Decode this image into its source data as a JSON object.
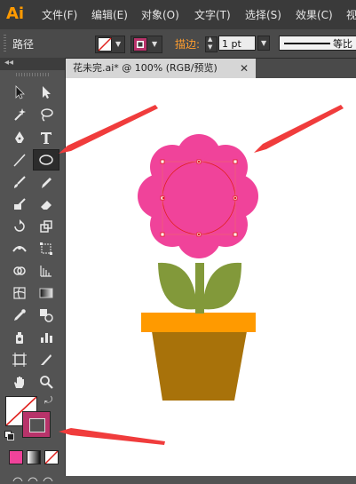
{
  "app": {
    "logo_text": "Ai",
    "menu": [
      "文件(F)",
      "编辑(E)",
      "对象(O)",
      "文字(T)",
      "选择(S)",
      "效果(C)",
      "视"
    ]
  },
  "control_bar": {
    "selection_label": "路径",
    "stroke_label": "描边:",
    "stroke_weight": "1 pt",
    "stroke_profile": "等比"
  },
  "document": {
    "tab_title": "花未完.ai* @ 100% (RGB/预览)",
    "close_glyph": "✕"
  },
  "toolbox": {
    "collapse_glyph": "◂◂",
    "tools": [
      {
        "name": "selection-tool"
      },
      {
        "name": "direct-selection-tool"
      },
      {
        "name": "magic-wand-tool"
      },
      {
        "name": "lasso-tool"
      },
      {
        "name": "pen-tool"
      },
      {
        "name": "type-tool"
      },
      {
        "name": "line-tool"
      },
      {
        "name": "ellipse-tool",
        "active": true
      },
      {
        "name": "paintbrush-tool"
      },
      {
        "name": "pencil-tool"
      },
      {
        "name": "blob-brush-tool"
      },
      {
        "name": "eraser-tool"
      },
      {
        "name": "rotate-tool"
      },
      {
        "name": "scale-tool"
      },
      {
        "name": "width-tool"
      },
      {
        "name": "free-transform-tool"
      },
      {
        "name": "shape-builder-tool"
      },
      {
        "name": "perspective-grid-tool"
      },
      {
        "name": "mesh-tool"
      },
      {
        "name": "gradient-tool"
      },
      {
        "name": "eyedropper-tool"
      },
      {
        "name": "blend-tool"
      },
      {
        "name": "symbol-sprayer-tool"
      },
      {
        "name": "column-graph-tool"
      },
      {
        "name": "artboard-tool"
      },
      {
        "name": "slice-tool"
      },
      {
        "name": "hand-tool"
      },
      {
        "name": "zoom-tool"
      }
    ]
  },
  "colors": {
    "petal_pink": "#f0439a",
    "leaf_green": "#82993a",
    "pot_rim": "#ff9a00",
    "pot_body": "#a8720a",
    "stroke_swatch": "#b8336a",
    "arrow_red": "#f03c3c",
    "ai_orange": "#ff9a00"
  }
}
